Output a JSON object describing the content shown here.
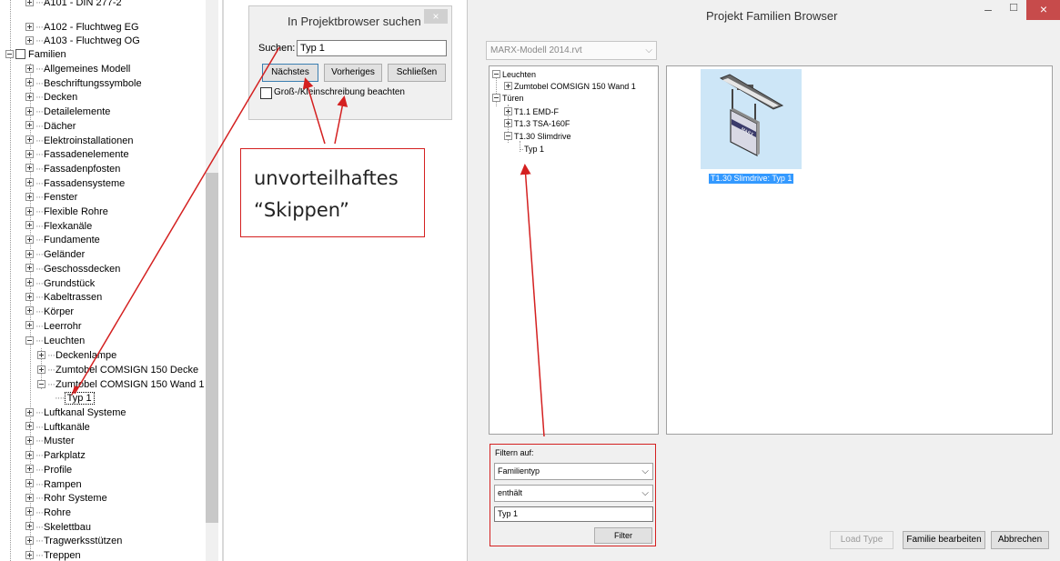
{
  "tree": {
    "top_items": [
      {
        "label": "A101 - DIN 277-2",
        "state": "plus"
      },
      {
        "label": "A102 - Fluchtweg EG",
        "state": "plus"
      },
      {
        "label": "A103 - Fluchtweg OG",
        "state": "plus"
      }
    ],
    "families_root": "Familien",
    "family_categories_a": [
      "Allgemeines Modell",
      "Beschriftungssymbole",
      "Decken",
      "Detailelemente",
      "Dächer",
      "Elektroinstallationen",
      "Fassadenelemente",
      "Fassadenpfosten",
      "Fassadensysteme",
      "Fenster",
      "Flexible Rohre",
      "Flexkanäle",
      "Fundamente",
      "Geländer",
      "Geschossdecken",
      "Grundstück",
      "Kabeltrassen",
      "Körper",
      "Leerrohr"
    ],
    "leuchten": {
      "label": "Leuchten",
      "children": [
        "Deckenlampe",
        "Zumtobel COMSIGN 150 Decke",
        "Zumtobel COMSIGN 150 Wand 1"
      ],
      "selected_type": "Typ 1"
    },
    "family_categories_b": [
      "Luftkanal Systeme",
      "Luftkanäle",
      "Muster",
      "Parkplatz",
      "Profile",
      "Rampen",
      "Rohr Systeme",
      "Rohre",
      "Skelettbau",
      "Tragwerksstützen",
      "Treppen"
    ]
  },
  "search_dialog": {
    "title": "In Projektbrowser suchen",
    "close_glyph": "×",
    "search_label": "Suchen:",
    "search_value": "Typ 1",
    "btn_next": "Nächstes",
    "btn_prev": "Vorheriges",
    "btn_close": "Schließen",
    "case_label": "Groß-/Kleinschreibung beachten"
  },
  "callout": {
    "line1": "unvorteilhaftes",
    "line2": "“Skippen”"
  },
  "family_browser": {
    "title": "Projekt Familien Browser",
    "min_glyph": "–",
    "max_glyph": "☐",
    "close_glyph": "×",
    "model_select": "MARX-Modell 2014.rvt",
    "tree": {
      "leuchten": "Leuchten",
      "leuchten_child": "Zumtobel COMSIGN 150 Wand 1",
      "tueren": "Türen",
      "tueren_children": [
        "T1.1 EMD-F",
        "T1.3 TSA-160F",
        "T1.30 Slimdrive"
      ],
      "slimdrive_type": "Typ 1"
    },
    "preview_caption": "T1.30 Slimdrive: Typ 1",
    "filter": {
      "label": "Filtern auf:",
      "type_value": "Familientyp",
      "condition_value": "enthält",
      "text_value": "Typ 1",
      "button": "Filter"
    },
    "buttons": {
      "load_type": "Load Type",
      "edit_family": "Familie bearbeiten",
      "cancel": "Abbrechen"
    }
  },
  "colors": {
    "annotation": "#d42020",
    "selection": "#3399ff",
    "thumb_bg": "#cde6f7"
  }
}
